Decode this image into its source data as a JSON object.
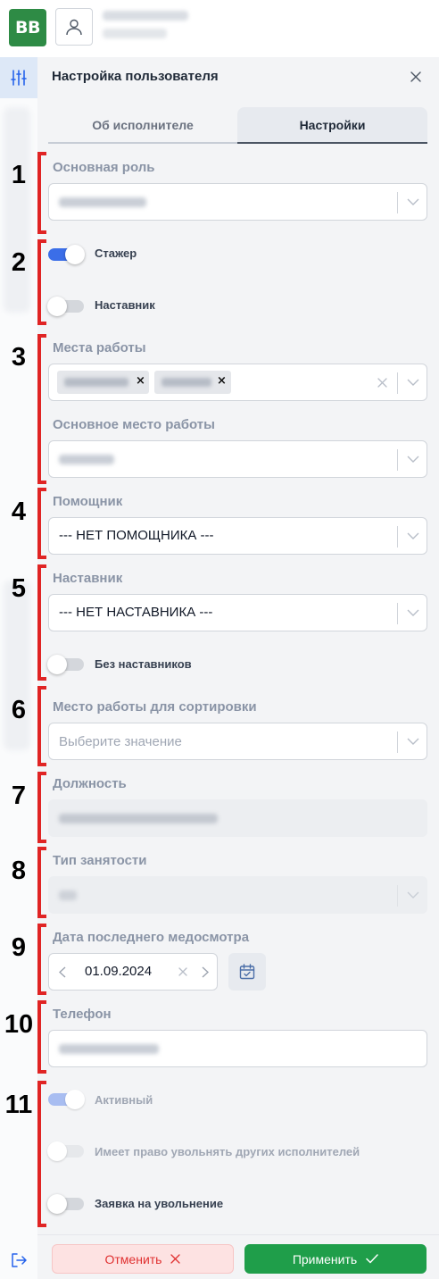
{
  "app": {
    "logo_text": "BB"
  },
  "panel": {
    "title": "Настройка пользователя",
    "tabs": [
      {
        "label": "Об исполнителе",
        "active": false
      },
      {
        "label": "Настройки",
        "active": true
      }
    ]
  },
  "form": {
    "main_role": {
      "label": "Основная роль"
    },
    "intern": {
      "label": "Стажер",
      "on": true
    },
    "mentor_toggle": {
      "label": "Наставник",
      "on": false
    },
    "work_places": {
      "label": "Места работы"
    },
    "main_work_place": {
      "label": "Основное место работы"
    },
    "assistant": {
      "label": "Помощник",
      "value": "--- НЕТ ПОМОЩНИКА ---"
    },
    "mentor": {
      "label": "Наставник",
      "value": "--- НЕТ НАСТАВНИКА ---"
    },
    "no_mentors": {
      "label": "Без наставников",
      "on": false
    },
    "sort_place": {
      "label": "Место работы для сортировки",
      "placeholder": "Выберите значение"
    },
    "position": {
      "label": "Должность"
    },
    "employment_type": {
      "label": "Тип занятости"
    },
    "medical_date": {
      "label": "Дата последнего медосмотра",
      "value": "01.09.2024"
    },
    "phone": {
      "label": "Телефон"
    },
    "active": {
      "label": "Активный",
      "on": true,
      "disabled": true
    },
    "can_fire": {
      "label": "Имеет право увольнять других исполнителей",
      "on": false,
      "disabled": true
    },
    "dismissal_request": {
      "label": "Заявка на увольнение",
      "on": false
    }
  },
  "annotations": [
    "1",
    "2",
    "3",
    "4",
    "5",
    "6",
    "7",
    "8",
    "9",
    "10",
    "11"
  ],
  "footer": {
    "cancel_label": "Отменить",
    "apply_label": "Применить"
  },
  "colors": {
    "accent": "#3b6ee8",
    "marker": "#e02424",
    "apply": "#1f9e4a",
    "cancel": "#e03131",
    "logo": "#2e8b45"
  }
}
